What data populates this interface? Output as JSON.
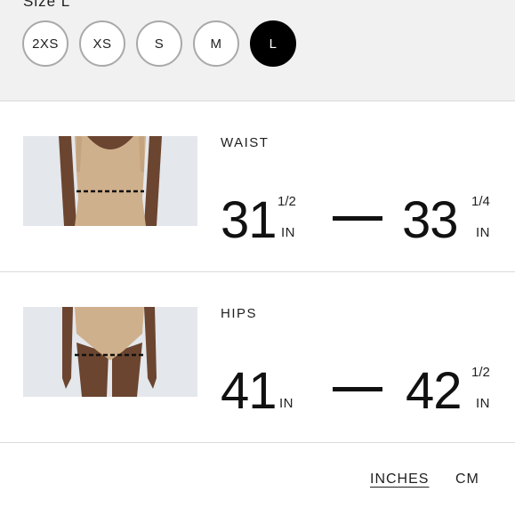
{
  "size_selector": {
    "label": "Size L",
    "options": [
      "2XS",
      "XS",
      "S",
      "M",
      "L"
    ],
    "selected": "L"
  },
  "measurements": {
    "waist": {
      "title": "WAIST",
      "min_whole": "31",
      "min_fraction": "1/2",
      "min_unit": "IN",
      "max_whole": "33",
      "max_fraction": "1/4",
      "max_unit": "IN"
    },
    "hips": {
      "title": "HIPS",
      "min_whole": "41",
      "min_unit": "IN",
      "max_whole": "42",
      "max_fraction": "1/2",
      "max_unit": "IN"
    }
  },
  "unit_toggle": {
    "inches_label": "INCHES",
    "cm_label": "CM",
    "selected": "INCHES"
  },
  "colors": {
    "selected_size_bg": "#000000",
    "panel_bg": "#f1f1f1",
    "text": "#111111"
  }
}
